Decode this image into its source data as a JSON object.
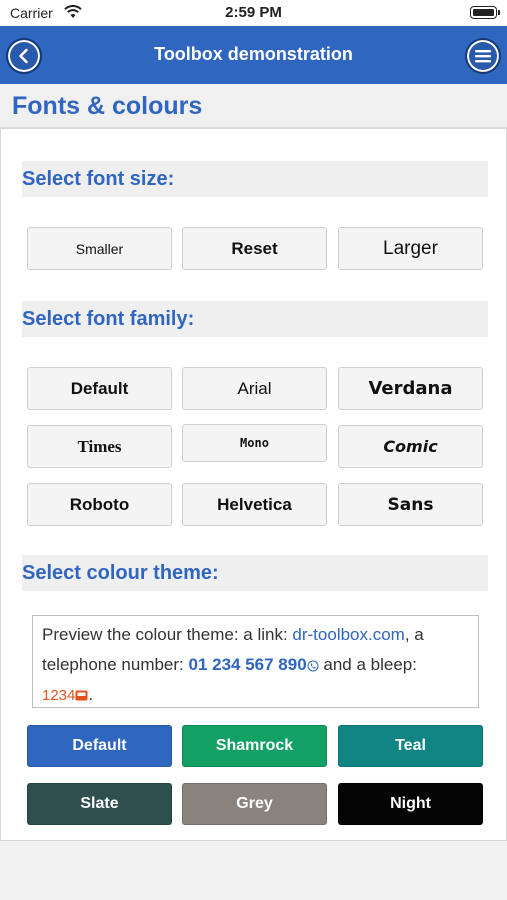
{
  "status_bar": {
    "carrier": "Carrier",
    "time": "2:59 PM"
  },
  "nav": {
    "title": "Toolbox demonstration",
    "back_icon": "chevron-left-icon",
    "menu_icon": "hamburger-menu-icon"
  },
  "page": {
    "heading": "Fonts & colours"
  },
  "font_size": {
    "title": "Select font size:",
    "buttons": [
      "Smaller",
      "Reset",
      "Larger"
    ]
  },
  "font_family": {
    "title": "Select font family:",
    "buttons": [
      "Default",
      "Arial",
      "Verdana",
      "Times",
      "Mono",
      "Comic",
      "Roboto",
      "Helvetica",
      "Sans"
    ]
  },
  "colour_theme": {
    "title": "Select colour theme:",
    "preview": {
      "text1": "Preview the colour theme: a link: ",
      "link": "dr-toolbox.com",
      "text2": ", a telephone number: ",
      "phone": "01 234 567 890",
      "text3": " and a bleep: ",
      "bleep": "1234",
      "text4": "."
    },
    "themes": [
      {
        "label": "Default",
        "color": "#2f66c0"
      },
      {
        "label": "Shamrock",
        "color": "#13a065"
      },
      {
        "label": "Teal",
        "color": "#118584"
      },
      {
        "label": "Slate",
        "color": "#2f4f4f"
      },
      {
        "label": "Grey",
        "color": "#8b837e"
      },
      {
        "label": "Night",
        "color": "#050505"
      }
    ]
  }
}
